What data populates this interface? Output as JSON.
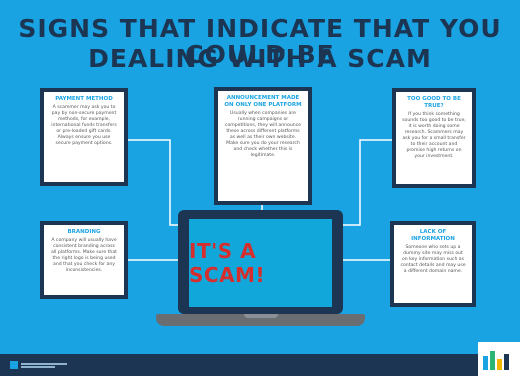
{
  "title": {
    "line1": "SIGNS THAT INDICATE THAT YOU COULD BE",
    "line2": "DEALING WITH A SCAM"
  },
  "cards": {
    "payment": {
      "heading": "PAYMENT METHOD",
      "body": "A scammer may ask you to pay by non-secure payment methods, for example, international funds transfers or pre-loaded gift cards. Always ensure you use secure payment options."
    },
    "announcement": {
      "heading": "ANNOUNCEMENT MADE ON ONLY ONE PLATFORM",
      "body": "Usually when companies are running campaigns or competitions, they will announce these across different platforms as well as their own website. Make sure you do your research and check whether this is legitimate."
    },
    "too_good": {
      "heading": "TOO GOOD TO BE TRUE?",
      "body": "If you think something sounds too good to be true, it is worth doing some research. Scammers may ask you for a small transfer to their account and promise high returns on your investment."
    },
    "branding": {
      "heading": "BRANDING",
      "body": "A company will usually have consistent branding across all platforms. Make sure that the right logo is being used and that you check for any inconsistencies."
    },
    "lack_info": {
      "heading": "LACK OF INFORMATION",
      "body": "Someone who sets up a dummy site may miss out on key information such as contact details and may use a different domain name."
    }
  },
  "laptop": {
    "screen_text": "IT'S A SCAM!"
  },
  "colors": {
    "background": "#1aa3e3",
    "navy": "#1b3553",
    "accent": "#d62d2d"
  }
}
